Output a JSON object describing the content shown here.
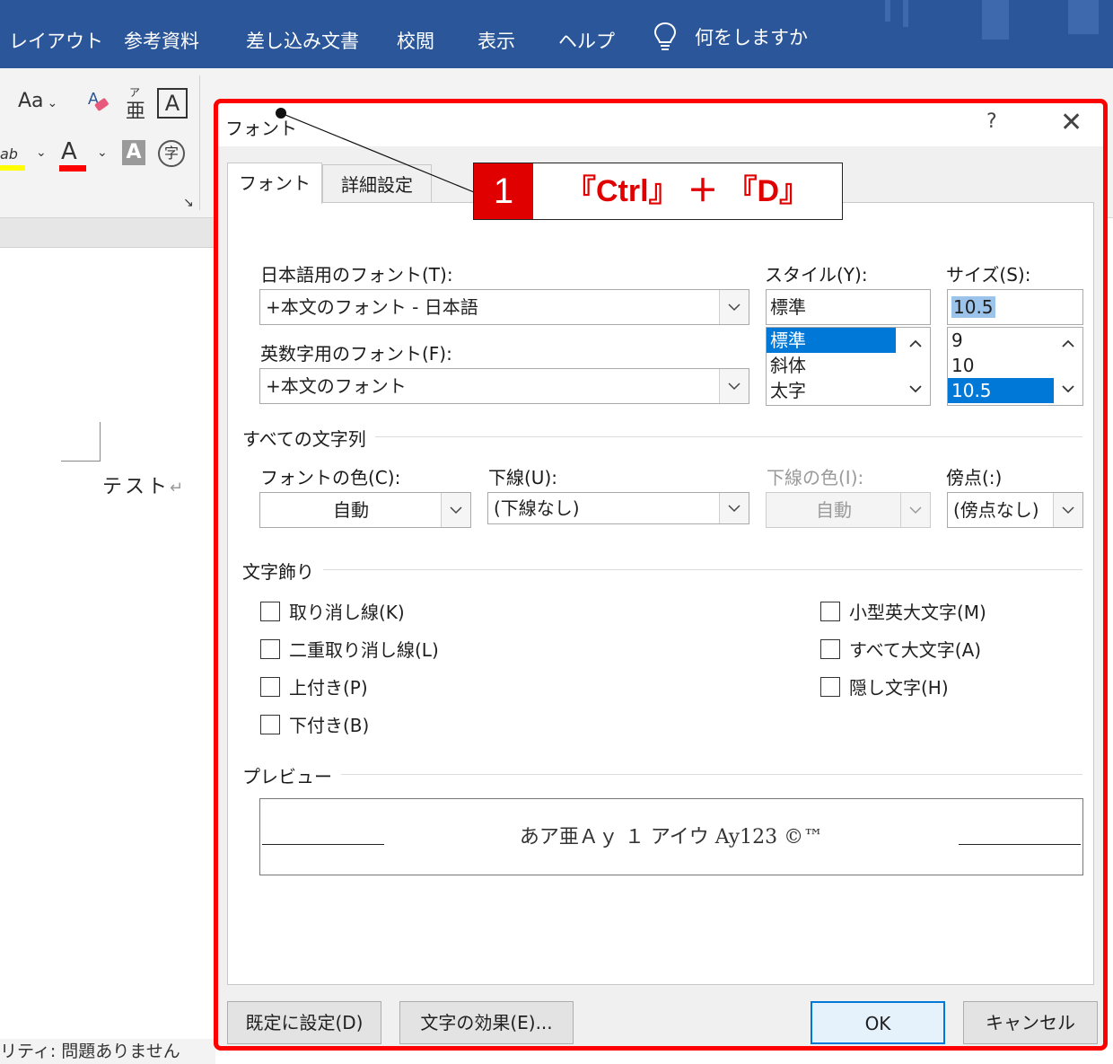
{
  "ribbon": {
    "tabs": [
      "レイアウト",
      "参考資料",
      "差し込み文書",
      "校閲",
      "表示",
      "ヘルプ"
    ],
    "tell_me": "何をしますか",
    "font_case_label": "Aa",
    "phonetic_glyph": "亜",
    "char_border_glyph": "A",
    "font_color_glyph": "A",
    "shade_glyph": "A",
    "enclose_glyph": "字",
    "highlight_glyph": "ab",
    "highlight_color": "#ffff00",
    "font_color": "#ff0000"
  },
  "document": {
    "text": "テスト",
    "return_mark": "↵",
    "status": "リティ: 問題ありません"
  },
  "dialog": {
    "title": "フォント",
    "help": "?",
    "close": "✕",
    "tabs": [
      "フォント",
      "詳細設定"
    ],
    "jp_font": {
      "label": "日本語用のフォント(T):",
      "value": "+本文のフォント - 日本語"
    },
    "latin_font": {
      "label": "英数字用のフォント(F):",
      "value": "+本文のフォント"
    },
    "style": {
      "label": "スタイル(Y):",
      "value": "標準",
      "options": [
        "標準",
        "斜体",
        "太字"
      ],
      "selected_index": 0
    },
    "size": {
      "label": "サイズ(S):",
      "value": "10.5",
      "options": [
        "9",
        "10",
        "10.5"
      ],
      "selected_index": 2
    },
    "all_text": {
      "header": "すべての文字列",
      "font_color": {
        "label": "フォントの色(C):",
        "value": "自動"
      },
      "underline": {
        "label": "下線(U):",
        "value": "(下線なし)"
      },
      "underline_color": {
        "label": "下線の色(I):",
        "value": "自動"
      },
      "emphasis": {
        "label": "傍点(:)",
        "value": "(傍点なし)"
      }
    },
    "effects": {
      "header": "文字飾り",
      "left": [
        "取り消し線(K)",
        "二重取り消し線(L)",
        "上付き(P)",
        "下付き(B)"
      ],
      "right": [
        "小型英大文字(M)",
        "すべて大文字(A)",
        "隠し文字(H)"
      ]
    },
    "preview": {
      "header": "プレビュー",
      "text": "あア亜Ａｙ １ アイウ Ay123 ©™"
    },
    "buttons": {
      "set_default": "既定に設定(D)",
      "text_effects": "文字の効果(E)...",
      "ok": "OK",
      "cancel": "キャンセル"
    }
  },
  "annotation": {
    "step": "1",
    "shortcut": "『Ctrl』 ＋ 『D』",
    "accent": "#e00000"
  }
}
